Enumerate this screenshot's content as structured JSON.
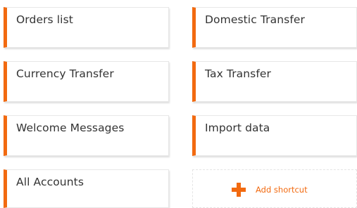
{
  "shortcuts": [
    {
      "label": "Orders list"
    },
    {
      "label": "Domestic Transfer"
    },
    {
      "label": "Currency Transfer"
    },
    {
      "label": "Tax Transfer"
    },
    {
      "label": "Welcome Messages"
    },
    {
      "label": "Import data"
    },
    {
      "label": "All Accounts"
    }
  ],
  "add_shortcut": {
    "label": "Add shortcut",
    "icon": "plus-icon"
  },
  "colors": {
    "accent": "#f26a10",
    "text": "#333333",
    "border": "#e7e7e7",
    "background": "#ffffff"
  }
}
